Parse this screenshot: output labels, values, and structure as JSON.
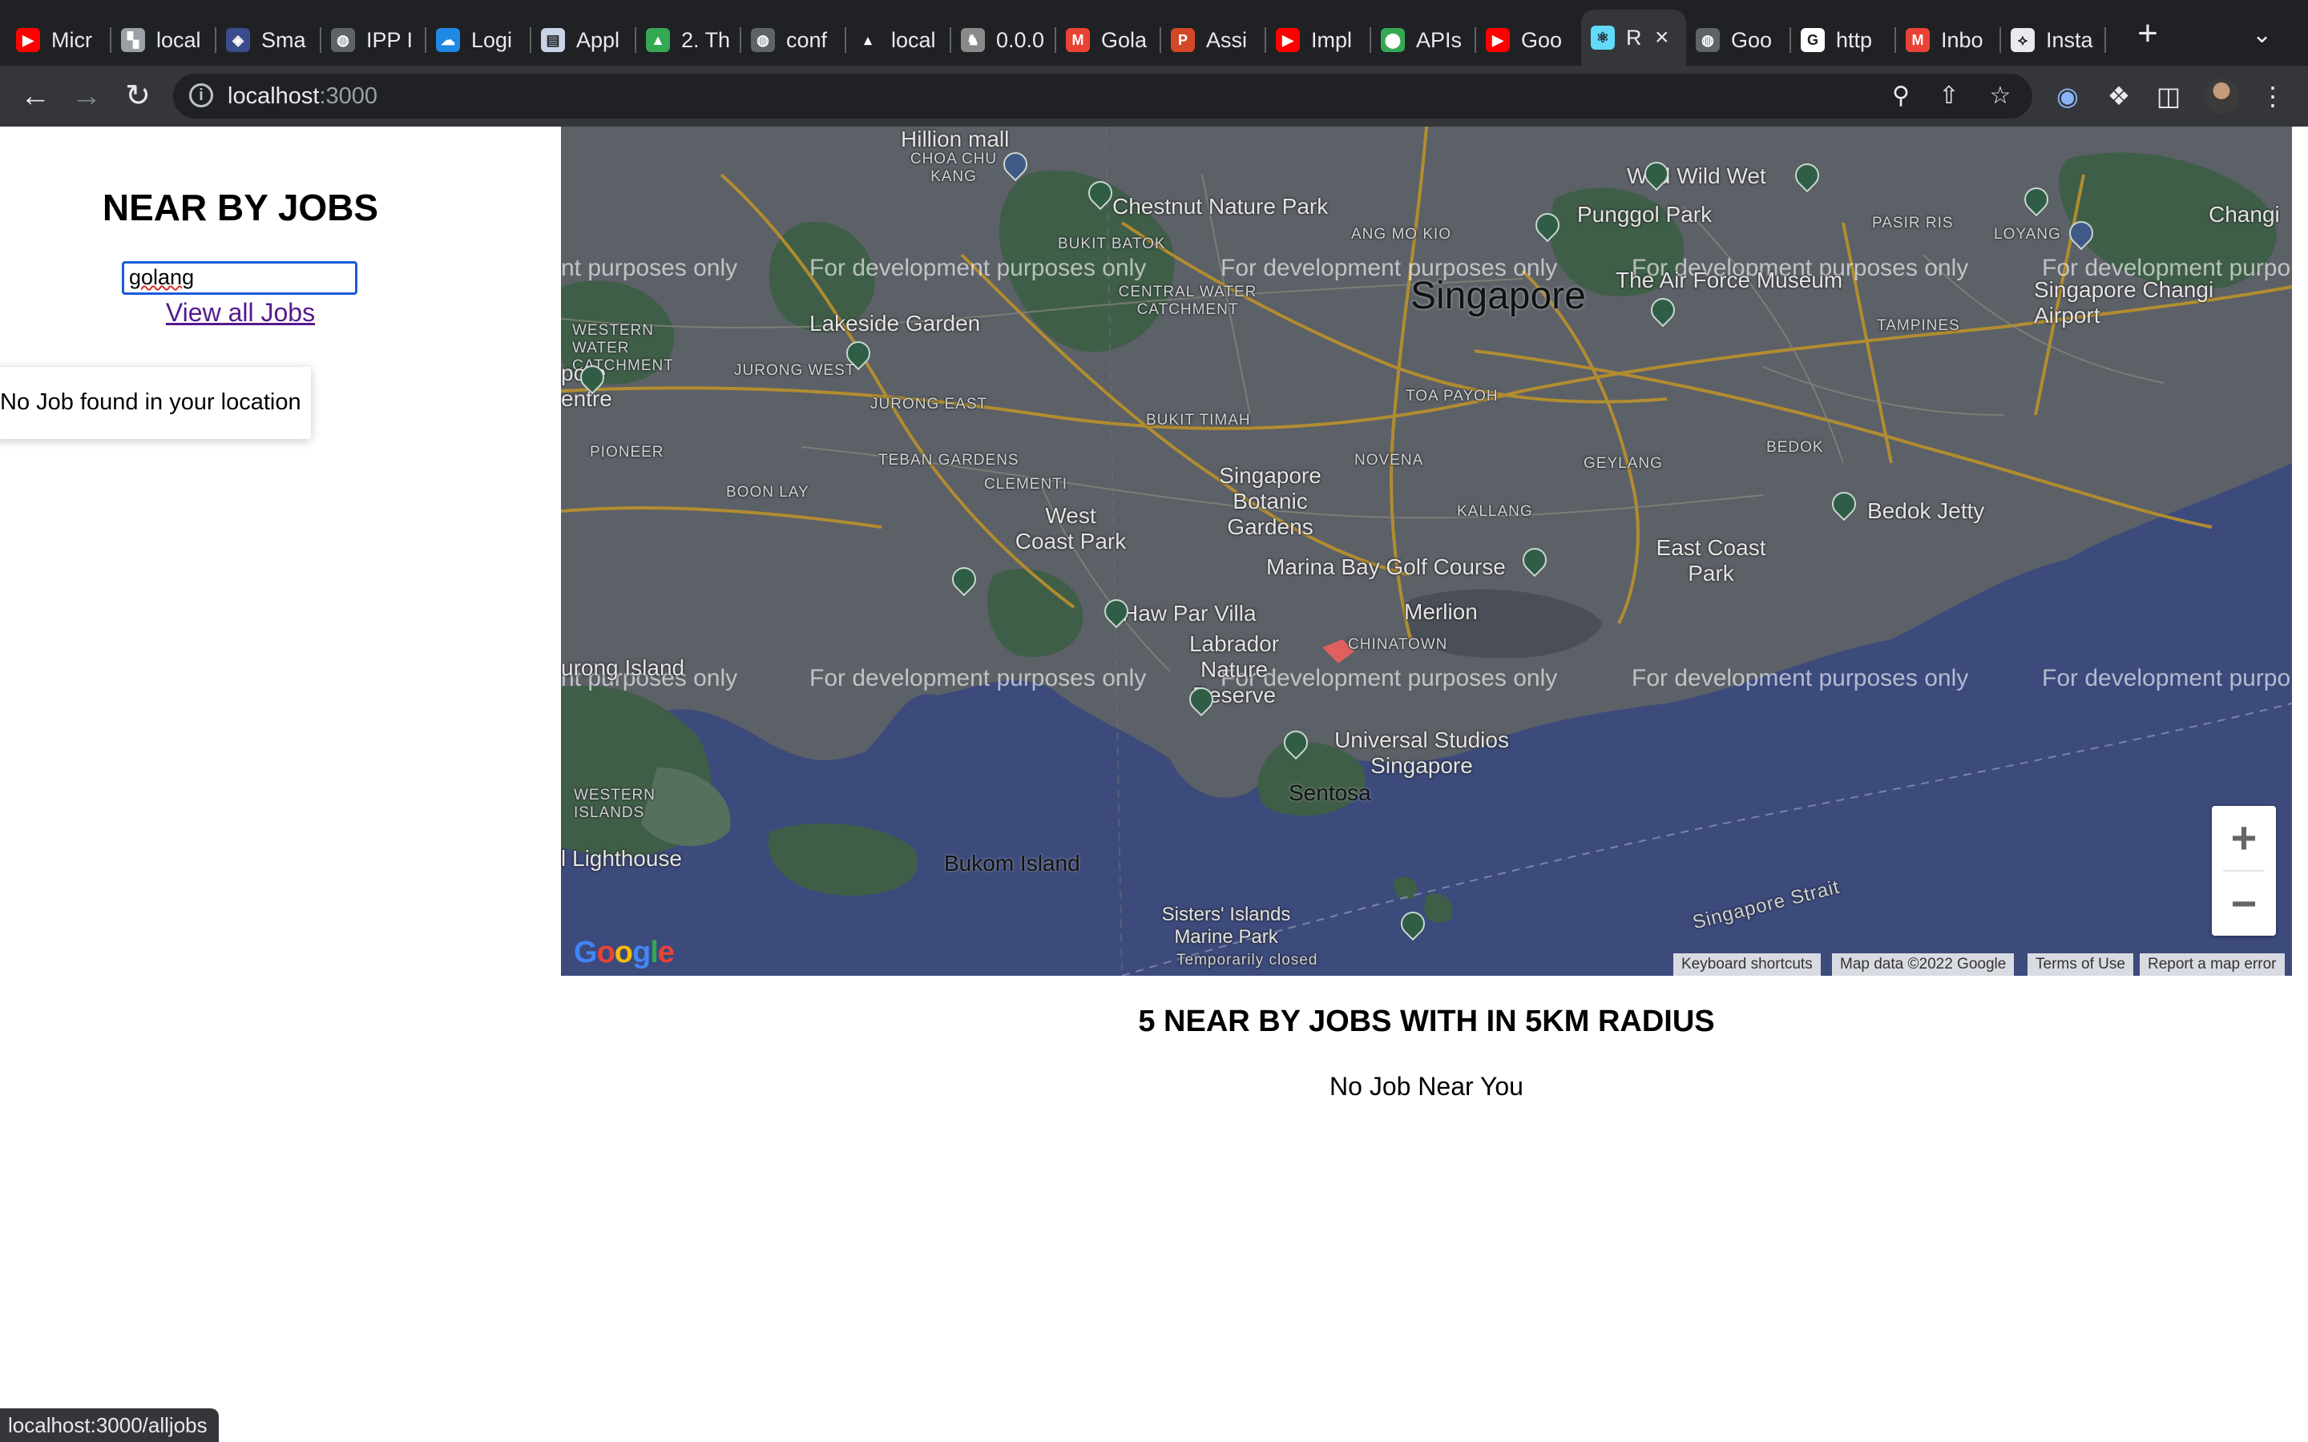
{
  "browser": {
    "tabs": [
      {
        "title": "Micr",
        "fav_color": "#ff0000",
        "fav_glyph": "▶"
      },
      {
        "title": "local",
        "fav_color": "#9aa0a6",
        "fav_glyph": "▚"
      },
      {
        "title": "Sma",
        "fav_color": "#3a4c8c",
        "fav_glyph": "◈"
      },
      {
        "title": "IPP I",
        "fav_color": "#5f6368",
        "fav_glyph": "◍"
      },
      {
        "title": "Logi",
        "fav_color": "#1e88e5",
        "fav_glyph": "☁"
      },
      {
        "title": "Appl",
        "fav_color": "#c9d3e6",
        "fav_glyph": "▤"
      },
      {
        "title": "2. Th",
        "fav_color": "#34a853",
        "fav_glyph": "▲"
      },
      {
        "title": "conf",
        "fav_color": "#5f6368",
        "fav_glyph": "◍"
      },
      {
        "title": "local",
        "fav_color": "#202124",
        "fav_glyph": "▴"
      },
      {
        "title": "0.0.0",
        "fav_color": "#8a8a8a",
        "fav_glyph": "♞"
      },
      {
        "title": "Gola",
        "fav_color": "#ea4335",
        "fav_glyph": "M"
      },
      {
        "title": "Assi",
        "fav_color": "#d24726",
        "fav_glyph": "P"
      },
      {
        "title": "Impl",
        "fav_color": "#ff0000",
        "fav_glyph": "▶"
      },
      {
        "title": "APIs",
        "fav_color": "#34a853",
        "fav_glyph": "⬤"
      },
      {
        "title": "Goo",
        "fav_color": "#ff0000",
        "fav_glyph": "▶"
      },
      {
        "title": "R",
        "fav_color": "#61dafb",
        "fav_glyph": "⚛",
        "active": true
      },
      {
        "title": "Goo",
        "fav_color": "#5f6368",
        "fav_glyph": "◍"
      },
      {
        "title": "http",
        "fav_color": "#ffffff",
        "fav_glyph": "G"
      },
      {
        "title": "Inbo",
        "fav_color": "#ea4335",
        "fav_glyph": "M"
      },
      {
        "title": "Insta",
        "fav_color": "#e8eaed",
        "fav_glyph": "⟡"
      }
    ],
    "new_tab_glyph": "+",
    "tab_search_glyph": "⌄",
    "url_host": "localhost",
    "url_port": ":3000",
    "status_text": "localhost:3000/alljobs"
  },
  "page": {
    "title": "NEAR BY JOBS",
    "search_value": "golang",
    "view_all_label": "View all Jobs",
    "no_job_card": "No Job found in your location",
    "results_title": "5 NEAR BY JOBS WITH IN 5KM RADIUS",
    "results_empty": "No Job Near You"
  },
  "map": {
    "watermark": "For development purposes only",
    "watermark_partial_left": "nt purposes only",
    "watermark_partial_right": "For development purpo",
    "labels": {
      "singapore": "Singapore",
      "punggol_park": "Punggol Park",
      "wild_wild_wet": "Wild Wild Wet",
      "changi_airport": "Singapore Changi Airport",
      "chestnut_nature_park": "Chestnut Nature Park",
      "hillion_mall": "Hillion mall",
      "lakeside_garden": "Lakeside Garden",
      "air_force_museum": "The Air Force Museum",
      "botanic_gardens": "Singapore Botanic Gardens",
      "west_coast_park": "West Coast Park",
      "marina_bay_golf": "Marina Bay Golf Course",
      "east_coast_park": "East Coast Park",
      "bedok_jetty": "Bedok Jetty",
      "merlion": "Merlion",
      "haw_par_villa": "Haw Par Villa",
      "labrador": "Labrador Nature Reserve",
      "universal_studios": "Universal Studios Singapore",
      "sentosa": "Sentosa",
      "bukom_island": "Bukom Island",
      "sisters_islands": "Sisters' Islands Marine Park",
      "temporarily_closed": "Temporarily closed",
      "lighthouse": "l Lighthouse",
      "jurong_island": "urong Island",
      "singapore_strait": "Singapore Strait",
      "changi": "Changi",
      "districts": {
        "choa_chu_kang": "CHOA CHU KANG",
        "bukit_batok": "BUKIT BATOK",
        "central_water": "CENTRAL WATER CATCHMENT",
        "ang_mo_kio": "ANG MO KIO",
        "pasir_ris": "PASIR RIS",
        "tampines": "TAMPINES",
        "loyang": "LOYANG",
        "western_water": "WESTERN WATER CATCHMENT",
        "jurong_west": "JURONG WEST",
        "jurong_east": "JURONG EAST",
        "toa_payoh": "TOA PAYOH",
        "bukit_timah": "BUKIT TIMAH",
        "pioneer": "PIONEER",
        "teban_gardens": "TEBAN GARDENS",
        "clementi": "CLEMENTI",
        "boon_lay": "BOON LAY",
        "novena": "NOVENA",
        "geylang": "GEYLANG",
        "bedok": "BEDOK",
        "kallang": "KALLANG",
        "chinatown": "CHINATOWN",
        "western_islands": "WESTERN ISLANDS",
        "tuas": "pore entre"
      }
    },
    "zoom_in": "+",
    "zoom_out": "−",
    "google": "Google",
    "attribution": {
      "shortcuts": "Keyboard shortcuts",
      "data": "Map data ©2022 Google",
      "terms": "Terms of Use",
      "report": "Report a map error"
    }
  }
}
